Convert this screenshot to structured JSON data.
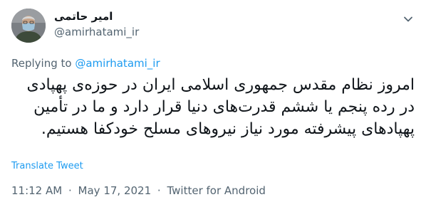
{
  "author": {
    "name": "امیر حاتمی",
    "handle": "@amirhatami_ir"
  },
  "reply": {
    "prefix": "Replying to",
    "mention": "@amirhatami_ir"
  },
  "tweet": {
    "text": "امروز نظام مقدس جمهوری اسلامی ایران در حوزه‌ی پهپادی در رده پنجم یا ششم قدرت‌های دنیا قرار دارد و ما در تأمین پهپادهای پیشرفته مورد نیاز نیروهای مسلح خودکفا هستیم."
  },
  "translate_label": "Translate Tweet",
  "meta": {
    "time": "11:12 AM",
    "date": "May 17, 2021",
    "source": "Twitter for Android",
    "separator": "·"
  },
  "colors": {
    "link": "#1d9bf0",
    "secondary_text": "#536471",
    "primary_text": "#0f1419"
  },
  "icons": {
    "avatar": "profile-photo",
    "caret": "chevron-down-icon"
  }
}
